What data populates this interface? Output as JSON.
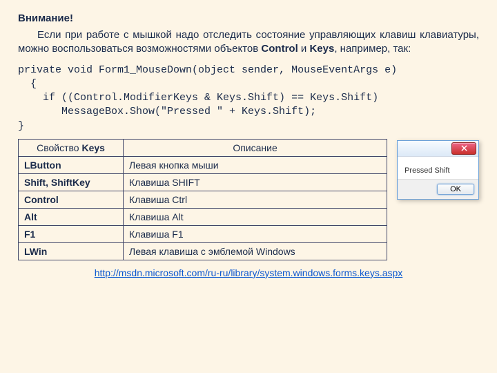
{
  "heading": "Внимание!",
  "para_pre": "Если при работе с мышкой надо отследить состояние управляющих клавиш клавиатуры, можно воспользоваться возможностями объектов ",
  "bold1": "Control",
  "para_mid": " и ",
  "bold2": "Keys",
  "para_post": ", например, так:",
  "code": "private void Form1_MouseDown(object sender, MouseEventArgs e)\n  {\n    if ((Control.ModifierKeys & Keys.Shift) == Keys.Shift)\n       MessageBox.Show(\"Pressed \" + Keys.Shift);\n}",
  "table": {
    "h1_pre": "Свойство ",
    "h1_bold": "Keys",
    "h2": "Описание",
    "rows": [
      {
        "k": "LButton",
        "v": "Левая кнопка мыши"
      },
      {
        "k": "Shift, ShiftKey",
        "v": "Клавиша SHIFT"
      },
      {
        "k": "Control",
        "v": "Клавиша Ctrl"
      },
      {
        "k": "Alt",
        "v": "Клавиша Alt"
      },
      {
        "k": "F1",
        "v": "Клавиша F1"
      },
      {
        "k": "LWin",
        "v": "Левая клавиша с эмблемой Windows"
      }
    ]
  },
  "dialog": {
    "message": "Pressed Shift",
    "ok": "OK"
  },
  "link_text": "http://msdn.microsoft.com/ru-ru/library/system.windows.forms.keys.aspx"
}
